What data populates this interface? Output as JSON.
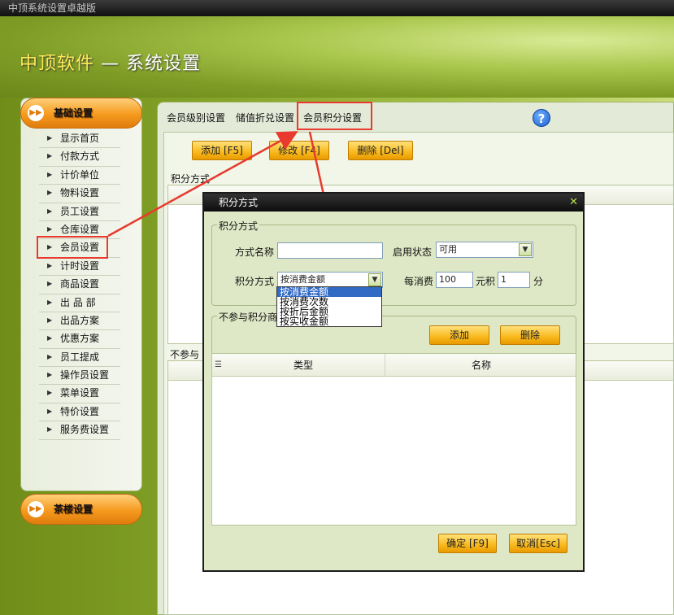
{
  "window": {
    "title": "中顶系统设置卓越版"
  },
  "header": {
    "brand": "中顶软件",
    "separator": "—",
    "subtitle": "系统设置"
  },
  "sidebar": {
    "group1": "基础设置",
    "items": [
      "显示首页",
      "付款方式",
      "计价单位",
      "物料设置",
      "员工设置",
      "仓库设置",
      "会员设置",
      "计时设置",
      "商品设置",
      "出 品 部",
      "出品方案",
      "优惠方案",
      "员工提成",
      "操作员设置",
      "菜单设置",
      "特价设置",
      "服务费设置"
    ],
    "group2": "茶楼设置"
  },
  "tabs": [
    "会员级别设置",
    "储值折兑设置",
    "会员积分设置"
  ],
  "help_icon": "?",
  "toolbar": {
    "add": "添加 [F5]",
    "edit": "修改 [F4]",
    "delete": "删除 [Del]"
  },
  "main": {
    "section1": "积分方式",
    "section2": "不参与"
  },
  "dialog": {
    "title": "积分方式",
    "close": "✕",
    "group1": "积分方式",
    "name_label": "方式名称",
    "name_value": "",
    "status_label": "启用状态",
    "status_value": "可用",
    "mode_label": "积分方式",
    "mode_value": "按消费金额",
    "per_label": "每消费",
    "per_value": "100",
    "unit_label": "元积",
    "points_value": "1",
    "points_unit": "分",
    "dropdown_options": [
      "按消费金额",
      "按消费次数",
      "按折后金额",
      "按实收金额"
    ],
    "group2": "不参与积分商品",
    "add_btn": "添加",
    "delete_btn": "删除",
    "table_headers": [
      "类型",
      "名称"
    ],
    "ok_btn": "确定 [F9]",
    "cancel_btn": "取消[Esc]"
  },
  "colors": {
    "accent_orange": "#f59a1e",
    "highlight_red": "#e83a2e",
    "selection_blue": "#316ac5"
  }
}
